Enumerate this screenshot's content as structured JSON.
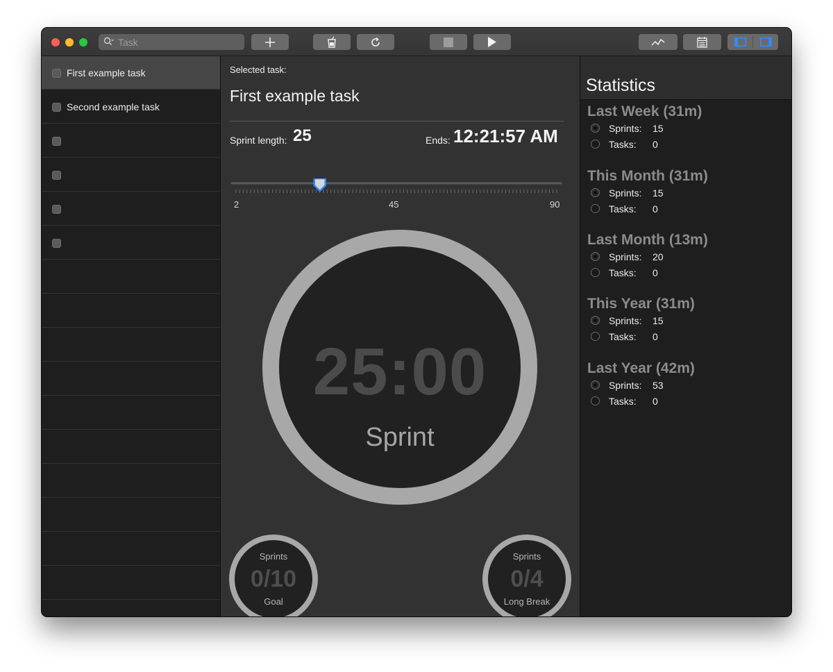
{
  "toolbar": {
    "search_placeholder": "Task",
    "search_value": "",
    "icons": [
      "add-icon",
      "break-cup-icon",
      "reset-icon",
      "stop-icon",
      "play-icon",
      "activity-chart-icon",
      "calendar-icon",
      "left-panel-icon",
      "right-panel-icon"
    ],
    "accent": "#2f8cff"
  },
  "sidebar": {
    "tasks": [
      {
        "label": "First example task",
        "selected": true
      },
      {
        "label": "Second example task",
        "selected": false
      },
      {
        "label": "",
        "selected": false
      },
      {
        "label": "",
        "selected": false
      },
      {
        "label": "",
        "selected": false
      },
      {
        "label": "",
        "selected": false
      }
    ]
  },
  "center": {
    "selected_label": "Selected task:",
    "selected_task": "First example task",
    "sprint_length_label": "Sprint length:",
    "sprint_length": "25",
    "ends_label": "Ends:",
    "ends_time": "12:21:57 AM",
    "slider": {
      "min": 2,
      "max": 90,
      "value": 25,
      "tick_labels": [
        "2",
        "45",
        "90"
      ]
    },
    "timer": {
      "time": "25:00",
      "mode": "Sprint"
    },
    "goal": {
      "top": "Sprints",
      "value": "0/10",
      "bottom": "Goal"
    },
    "long_break": {
      "top": "Sprints",
      "value": "0/4",
      "bottom": "Long Break"
    }
  },
  "stats": {
    "title": "Statistics",
    "periods": [
      {
        "name": "Last Week (31m)",
        "sprints_label": "Sprints:",
        "sprints": "15",
        "tasks_label": "Tasks:",
        "tasks": "0"
      },
      {
        "name": "This Month (31m)",
        "sprints_label": "Sprints:",
        "sprints": "15",
        "tasks_label": "Tasks:",
        "tasks": "0"
      },
      {
        "name": "Last Month (13m)",
        "sprints_label": "Sprints:",
        "sprints": "20",
        "tasks_label": "Tasks:",
        "tasks": "0"
      },
      {
        "name": "This Year (31m)",
        "sprints_label": "Sprints:",
        "sprints": "15",
        "tasks_label": "Tasks:",
        "tasks": "0"
      },
      {
        "name": "Last Year (42m)",
        "sprints_label": "Sprints:",
        "sprints": "53",
        "tasks_label": "Tasks:",
        "tasks": "0"
      }
    ]
  }
}
